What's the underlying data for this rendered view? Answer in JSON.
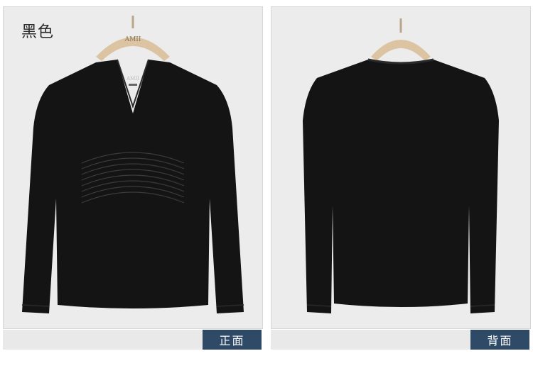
{
  "color_label": "黑色",
  "hanger_brand": "AMII",
  "shirt_tag_brand": "AMII",
  "front_view_label": "正面",
  "back_view_label": "背面",
  "colors": {
    "garment": "#141414",
    "background": "#ececec",
    "badge": "#2f4a66",
    "hanger": "#dcc3a2"
  }
}
